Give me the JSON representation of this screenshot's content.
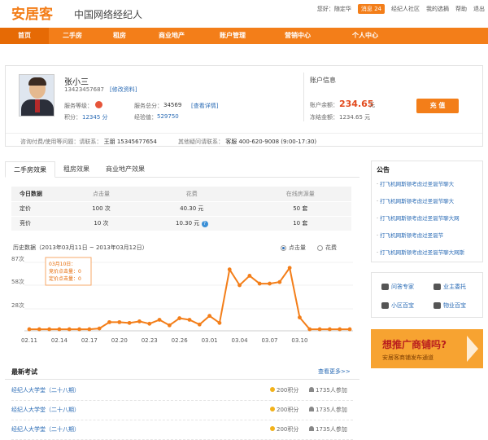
{
  "header": {
    "logo": "安居客",
    "tagline": "中国网络经纪人",
    "greeting": "您好：随定华",
    "messages": "消息 24",
    "community": "经纪人社区",
    "my_links": "我的选摘",
    "help": "帮助",
    "logout": "退出"
  },
  "nav": [
    "首页",
    "二手房",
    "租房",
    "商业地产",
    "账户管理",
    "营销中心",
    "个人中心"
  ],
  "profile": {
    "name": "张小三",
    "phone": "13423457687",
    "edit_link": "[修改资料]",
    "service_level_label": "服务等级：",
    "service_score_label": "服务总分：",
    "service_score": "34569",
    "view_detail": "[查看详情]",
    "points_label": "积分：",
    "points": "12345 分",
    "exp_label": "经验值：",
    "exp": "529750",
    "account_title": "账户信息",
    "balance_label": "账户余额：",
    "balance": "234.65",
    "balance_unit": "元",
    "frozen_label": "冻结金额：",
    "frozen": "1234.65 元",
    "recharge": "充 值",
    "support_label": "咨询付费/使用等问题：请联系：",
    "support_name": "王朋",
    "support_phone": "15345677654",
    "other_label": "其他疑问请联系：",
    "other_name": "客服",
    "other_phone": "400-620-9008 (9:00-17:30)"
  },
  "tabs": [
    "二手房效果",
    "租房效果",
    "商业地产效果"
  ],
  "effect_table": {
    "headers": [
      "今日数据",
      "点击量",
      "花费",
      "在线房源量"
    ],
    "rows": [
      [
        "定价",
        "100 次",
        "40.30 元",
        "50 套"
      ],
      [
        "竞价",
        "10 次",
        "10.30 元",
        "10 套"
      ]
    ]
  },
  "history": {
    "label": "历史数据（2013年03月11日 ~ 2013年03月12日）",
    "legend": [
      "点击量",
      "花费"
    ],
    "tooltip": [
      "03月10日：",
      "竞价点击量：0",
      "定价点击量：0"
    ]
  },
  "chart_data": {
    "type": "line",
    "xlabel": "",
    "ylabel": "",
    "ylim": [
      0,
      87
    ],
    "yticks": [
      "87次",
      "58次",
      "28次"
    ],
    "ytick_values": [
      87,
      58,
      28
    ],
    "xticks": [
      "02.11",
      "02.14",
      "02.17",
      "02.20",
      "02.23",
      "02.26",
      "03.01",
      "03.04",
      "03.07",
      "03.10"
    ],
    "xtick_index": [
      0,
      3,
      6,
      9,
      12,
      15,
      18,
      21,
      24,
      27
    ],
    "series": [
      {
        "values": [
          2,
          2,
          2,
          2,
          2,
          2,
          2,
          3,
          11,
          11,
          10,
          12,
          9,
          14,
          7,
          16,
          14,
          8,
          19,
          10,
          78,
          58,
          70,
          60,
          60,
          62,
          80,
          17,
          2,
          2,
          2,
          2,
          2
        ],
        "color": "#f37e19"
      }
    ]
  },
  "exams": {
    "title": "最新考试",
    "more": "查看更多>>",
    "rows": [
      {
        "title": "经纪人大学堂（二十八期）",
        "points": "200积分",
        "count": "1735人参加"
      },
      {
        "title": "经纪人大学堂（二十八期）",
        "points": "200积分",
        "count": "1735人参加"
      },
      {
        "title": "经纪人大学堂（二十八期）",
        "points": "200积分",
        "count": "1735人参加"
      }
    ]
  },
  "notice": {
    "title": "公告",
    "items": [
      "打飞机网斯顿考虑过圣诞节聊大",
      "打飞机网斯顿考虑过圣诞节聊大",
      "打飞机网斯顿考虑过圣诞节聊大网",
      "打飞机网斯顿考虑过圣诞节",
      "打飞机网斯顿考虑过圣诞节聊大网斯"
    ]
  },
  "tools": [
    "问答专家",
    "业主委托",
    "小区百宝",
    "物业百宝"
  ],
  "ad": {
    "headline": "想推广商铺吗?",
    "subline": "安居客商铺发布通道"
  },
  "colors": {
    "brand": "#f37e19",
    "link": "#2a6bb5",
    "accent_red": "#e24a1d"
  }
}
